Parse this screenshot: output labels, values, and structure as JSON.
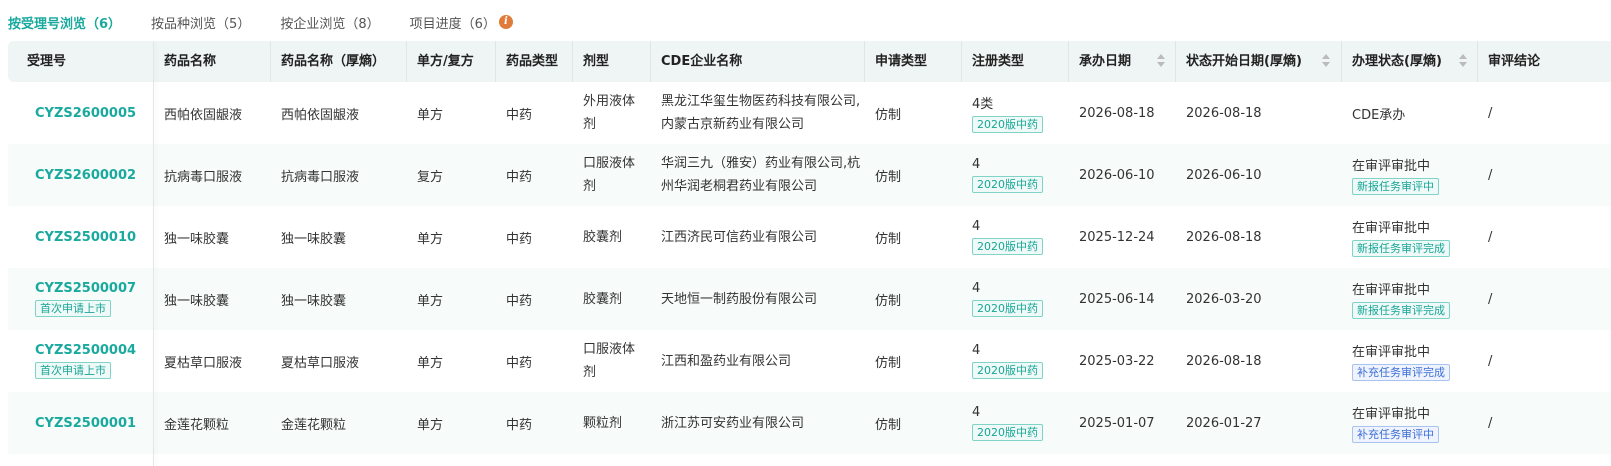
{
  "tabs": [
    {
      "label": "按受理号浏览（6）",
      "active": true
    },
    {
      "label": "按品种浏览（5）",
      "active": false
    },
    {
      "label": "按企业浏览（8）",
      "active": false
    },
    {
      "label": "项目进度（6）",
      "active": false,
      "icon": "info-icon"
    }
  ],
  "info_icon_glyph": "i",
  "columns": [
    "受理号",
    "药品名称",
    "药品名称（厚熵）",
    "单方/复方",
    "药品类型",
    "剂型",
    "CDE企业名称",
    "申请类型",
    "注册类型",
    "承办日期",
    "状态开始日期(厚熵)",
    "办理状态(厚熵)",
    "审评结论"
  ],
  "rows": [
    {
      "accept": "CYZS2600005",
      "accept_badge": "",
      "name": "西帕依固龈液",
      "name2": "西帕依固龈液",
      "formula": "单方",
      "type": "中药",
      "dosage": [
        "外用液体",
        "剂"
      ],
      "company": [
        "黑龙江华玺生物医药科技有限公司,",
        "内蒙古京新药业有限公司"
      ],
      "apply": "仿制",
      "reg": "4类",
      "reg_badge": "2020版中药",
      "date1": "2026-08-18",
      "date2": "2026-08-18",
      "status": "CDE承办",
      "status_badge": "",
      "status_badge_color": "",
      "conclusion": "/"
    },
    {
      "accept": "CYZS2600002",
      "accept_badge": "",
      "name": "抗病毒口服液",
      "name2": "抗病毒口服液",
      "formula": "复方",
      "type": "中药",
      "dosage": [
        "口服液体",
        "剂"
      ],
      "company": [
        "华润三九（雅安）药业有限公司,杭",
        "州华润老桐君药业有限公司"
      ],
      "apply": "仿制",
      "reg": "4",
      "reg_badge": "2020版中药",
      "date1": "2026-06-10",
      "date2": "2026-06-10",
      "status": "在审评审批中",
      "status_badge": "新报任务审评中",
      "status_badge_color": "green",
      "conclusion": "/"
    },
    {
      "accept": "CYZS2500010",
      "accept_badge": "",
      "name": "独一味胶囊",
      "name2": "独一味胶囊",
      "formula": "单方",
      "type": "中药",
      "dosage": [
        "胶囊剂"
      ],
      "company": [
        "江西济民可信药业有限公司"
      ],
      "apply": "仿制",
      "reg": "4",
      "reg_badge": "2020版中药",
      "date1": "2025-12-24",
      "date2": "2026-08-18",
      "status": "在审评审批中",
      "status_badge": "新报任务审评完成",
      "status_badge_color": "green",
      "conclusion": "/"
    },
    {
      "accept": "CYZS2500007",
      "accept_badge": "首次申请上市",
      "name": "独一味胶囊",
      "name2": "独一味胶囊",
      "formula": "单方",
      "type": "中药",
      "dosage": [
        "胶囊剂"
      ],
      "company": [
        "天地恒一制药股份有限公司"
      ],
      "apply": "仿制",
      "reg": "4",
      "reg_badge": "2020版中药",
      "date1": "2025-06-14",
      "date2": "2026-03-20",
      "status": "在审评审批中",
      "status_badge": "新报任务审评完成",
      "status_badge_color": "green",
      "conclusion": "/"
    },
    {
      "accept": "CYZS2500004",
      "accept_badge": "首次申请上市",
      "name": "夏枯草口服液",
      "name2": "夏枯草口服液",
      "formula": "单方",
      "type": "中药",
      "dosage": [
        "口服液体",
        "剂"
      ],
      "company": [
        "江西和盈药业有限公司"
      ],
      "apply": "仿制",
      "reg": "4",
      "reg_badge": "2020版中药",
      "date1": "2025-03-22",
      "date2": "2026-08-18",
      "status": "在审评审批中",
      "status_badge": "补充任务审评完成",
      "status_badge_color": "blue",
      "conclusion": "/"
    },
    {
      "accept": "CYZS2500001",
      "accept_badge": "",
      "name": "金莲花颗粒",
      "name2": "金莲花颗粒",
      "formula": "单方",
      "type": "中药",
      "dosage": [
        "颗粒剂"
      ],
      "company": [
        "浙江苏可安药业有限公司"
      ],
      "apply": "仿制",
      "reg": "4",
      "reg_badge": "2020版中药",
      "date1": "2025-01-07",
      "date2": "2026-01-27",
      "status": "在审评审批中",
      "status_badge": "补充任务审评中",
      "status_badge_color": "blue",
      "conclusion": "/"
    }
  ]
}
